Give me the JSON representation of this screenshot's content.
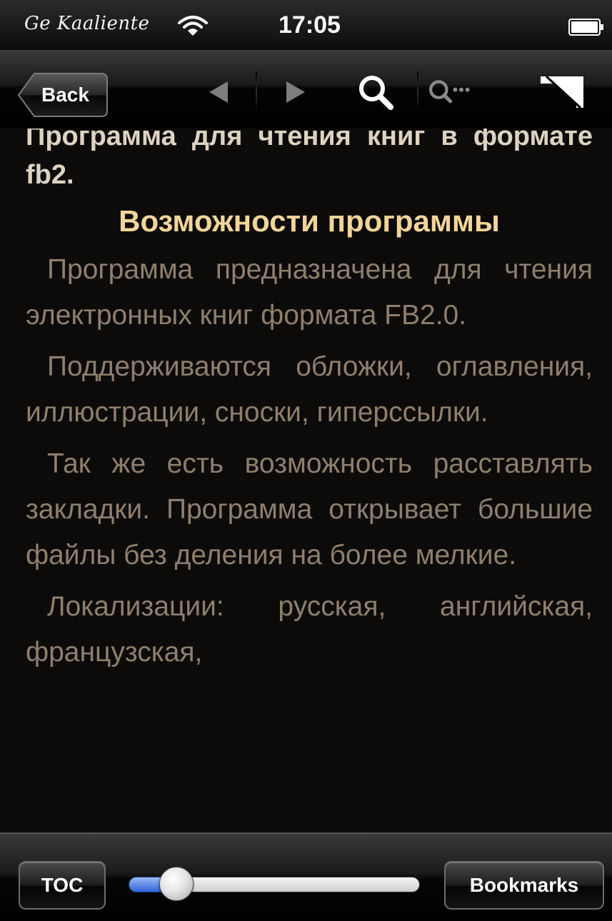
{
  "status_bar": {
    "carrier": "Ge Kaaliente",
    "time": "17:05",
    "icons": [
      "wifi-icon",
      "battery-icon"
    ]
  },
  "toolbar": {
    "back_label": "Back",
    "icons": [
      "prev-page-icon",
      "next-page-icon",
      "search-icon",
      "search-next-icon",
      "fullscreen-icon"
    ]
  },
  "content": {
    "lead": "Программа для чтения книг в формате fb2.",
    "heading": "Возможности программы",
    "paragraphs": [
      "Программа предназначена для чтения электронных книг формата FB2.0.",
      "Поддерживаются обложки, оглавления, иллюстрации, сноски, гиперссылки.",
      "Так же есть возможность расставлять закладки. Программа открывает большие файлы без деления на более мелкие.",
      "Локализации: русская, английская, французская,"
    ]
  },
  "bottom_bar": {
    "toc_label": "TOC",
    "bookmarks_label": "Bookmarks",
    "progress": 0.12
  },
  "colors": {
    "background": "#0d0b09",
    "lead_text": "#ddd3c2",
    "heading_text": "#f2d59a",
    "body_text": "#8e7f6d",
    "slider_fill": "#2f66d8"
  }
}
